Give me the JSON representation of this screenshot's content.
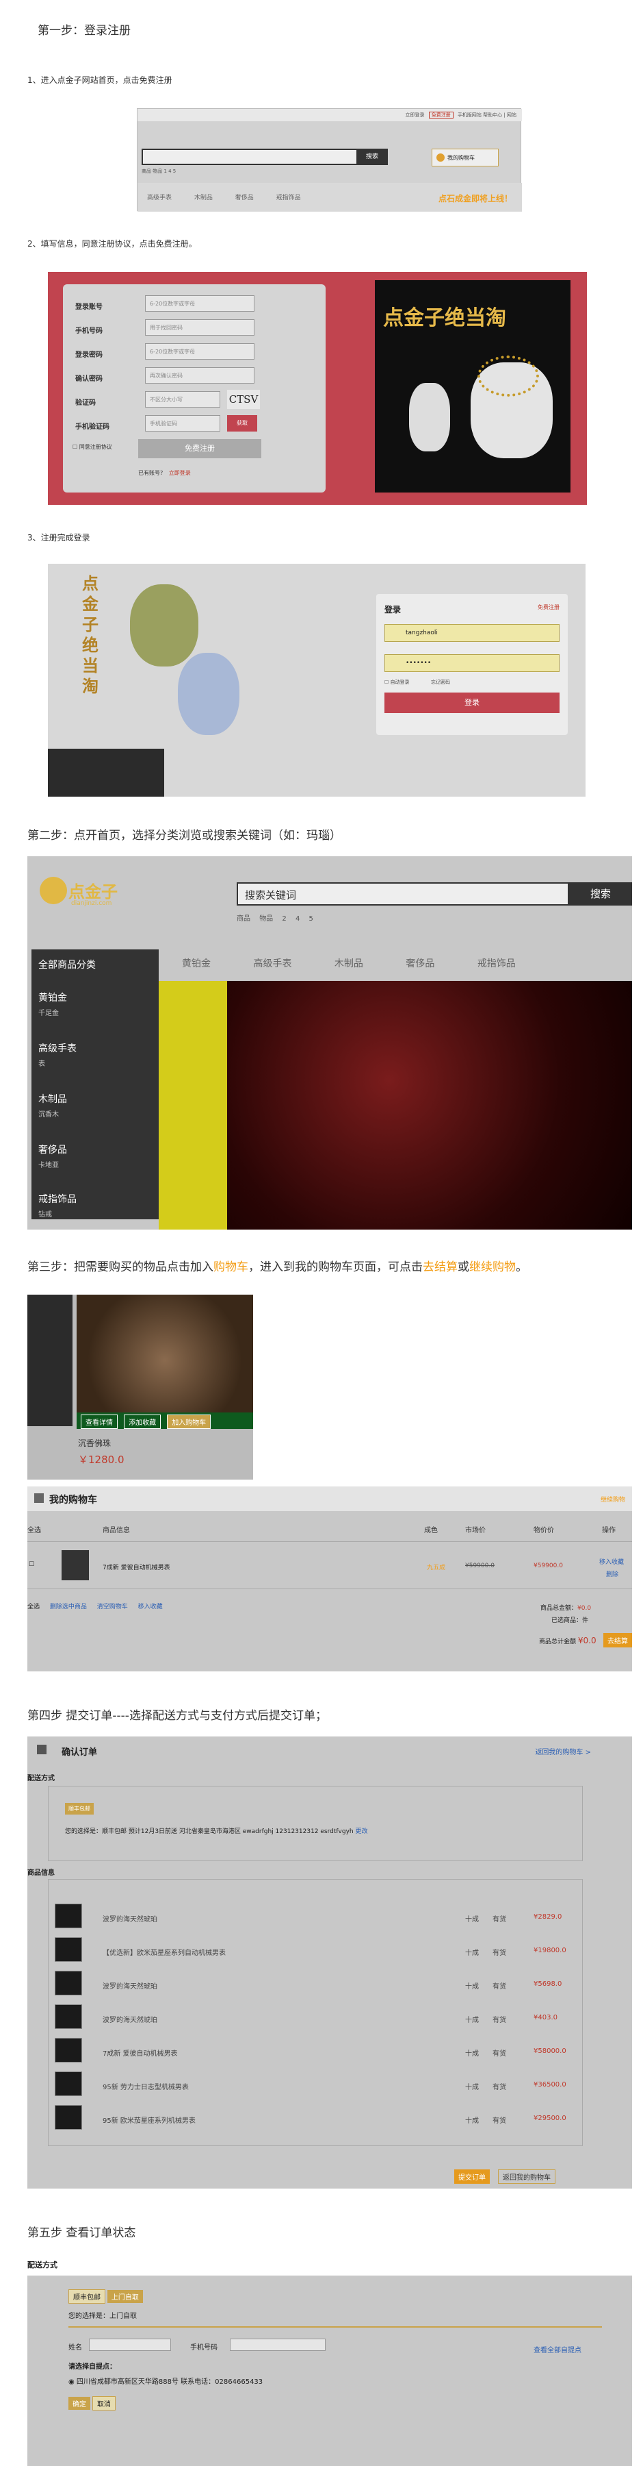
{
  "step1": {
    "title": "第一步：登录注册",
    "sub1": "1、进入点金子网站首页，点击免费注册",
    "sub2": "2、填写信息，同意注册协议，点击免费注册。",
    "sub3": "3、注册完成登录",
    "home_mini": {
      "toplinks": [
        "立即登录",
        "免费注册",
        "手机版网站",
        "帮助中心",
        "|",
        "网站"
      ],
      "search_btn": "搜索",
      "hotwords": "商品 物品 1 4 5",
      "cart": "我的购物车",
      "tabs": [
        "高级手表",
        "木制品",
        "奢侈品",
        "戒指饰品"
      ],
      "slogan": "点石成金即将上线！"
    },
    "reg_form": {
      "fields": [
        {
          "label": "登录账号",
          "ph": "6-20位数字或字母"
        },
        {
          "label": "手机号码",
          "ph": "用于找回密码"
        },
        {
          "label": "登录密码",
          "ph": "6-20位数字或字母"
        },
        {
          "label": "确认密码",
          "ph": "再次确认密码"
        },
        {
          "label": "验证码",
          "ph": "不区分大小写"
        },
        {
          "label": "手机验证码",
          "ph": "手机验证码"
        }
      ],
      "captcha": "CTSV",
      "sms_btn": "获取",
      "agree": "同意注册协议",
      "submit": "免费注册",
      "has_account": "已有账号?",
      "login_link": "立即登录",
      "banner_title": "点金子绝当淘"
    },
    "login_mini": {
      "vertical_text": "点金子绝当淘",
      "title": "登录",
      "reg_link": "免费注册",
      "user_value": "tangzhaoli",
      "pwd_value": "•••••••",
      "remember": "自动登录",
      "forgot": "忘记密码",
      "submit": "登录"
    }
  },
  "step2": {
    "title": "第二步：点开首页，选择分类浏览或搜索关键词（如：玛瑙）",
    "logo_text": "点金子",
    "logo_sub": "dianjinzi.com",
    "search_placeholder": "搜索关键词",
    "search_btn": "搜索",
    "hotwords": [
      "商品",
      "物品",
      "2",
      "4",
      "5"
    ],
    "all_cats": "全部商品分类",
    "nav": [
      "黄铂金",
      "高级手表",
      "木制品",
      "奢侈品",
      "戒指饰品"
    ],
    "cats": [
      {
        "name": "黄铂金",
        "sub": "千足金"
      },
      {
        "name": "高级手表",
        "sub": "表"
      },
      {
        "name": "木制品",
        "sub": "沉香木"
      },
      {
        "name": "奢侈品",
        "sub": "卡地亚"
      },
      {
        "name": "戒指饰品",
        "sub": "钻戒"
      }
    ]
  },
  "step3": {
    "title_a": "第三步：把需要购买的物品点击加入",
    "title_cart": "购物车",
    "title_b": "，进入到我的购物车页面，可点击",
    "title_checkout": "去结算",
    "title_or": "或",
    "title_continue": "继续购物",
    "title_end": "。",
    "product_btns": [
      "查看详情",
      "添加收藏",
      "加入购物车"
    ],
    "product_name": "沉香佛珠",
    "product_price": "￥1280.0",
    "cart_title": "我的购物车",
    "continue_link": "继续购物",
    "headers": [
      "全选",
      "商品信息",
      "成色",
      "市场价",
      "物价价",
      "操作"
    ],
    "item_name": "7成新 爱彼自动机械男表",
    "item_cond": "九五成",
    "item_market": "¥59900.0",
    "item_price": "¥59900.0",
    "item_ops": [
      "移入收藏",
      "删除"
    ],
    "bottom_links": [
      "全选",
      "删除选中商品",
      "清空购物车",
      "移入收藏"
    ],
    "total_label": "商品总金额：",
    "total_val": "¥0.0",
    "selected_label": "已选商品：",
    "selected_val": "件",
    "grand_label": "商品总计金额",
    "grand_val": "¥0.0",
    "checkout_btn": "去结算"
  },
  "step4": {
    "title": "第四步 提交订单----选择配送方式与支付方式后提交订单；",
    "box_title": "确认订单",
    "back_link": "返回我的购物车 >",
    "ship_label": "配送方式",
    "ship_tag": "顺丰包邮",
    "ship_text": "您的选择是：顺丰包邮 预计12月3日前送 河北省秦皇岛市海港区 ewadrfghj 12312312312 esrdtfvgyh",
    "ship_change": "更改",
    "goods_label": "商品信息",
    "rows": [
      {
        "name": "波罗的海天然琥珀",
        "q": "十成",
        "s": "有货",
        "p": "¥2829.0"
      },
      {
        "name": "【优选新】欧米茄星座系列自动机械男表",
        "q": "十成",
        "s": "有货",
        "p": "¥19800.0"
      },
      {
        "name": "波罗的海天然琥珀",
        "q": "十成",
        "s": "有货",
        "p": "¥5698.0"
      },
      {
        "name": "波罗的海天然琥珀",
        "q": "十成",
        "s": "有货",
        "p": "¥403.0"
      },
      {
        "name": "7成新 爱彼自动机械男表",
        "q": "十成",
        "s": "有货",
        "p": "¥58000.0"
      },
      {
        "name": "95新 劳力士日志型机械男表",
        "q": "十成",
        "s": "有货",
        "p": "¥36500.0"
      },
      {
        "name": "95新 欧米茄星座系列机械男表",
        "q": "十成",
        "s": "有货",
        "p": "¥29500.0"
      }
    ],
    "submit_btn": "提交订单",
    "back_btn": "返回我的购物车"
  },
  "step5": {
    "title": "第五步 查看订单状态",
    "ship_label": "配送方式",
    "tabs": [
      "顺丰包邮",
      "上门自取"
    ],
    "choice": "您的选择是：上门自取",
    "name_label": "姓名",
    "phone_label": "手机号码",
    "pickup_label": "请选择自提点：",
    "pickup_addr": "四川省成都市高新区天华路888号 联系电话：02864665433",
    "all_points": "查看全部自提点",
    "btns": [
      "确定",
      "取消"
    ]
  }
}
